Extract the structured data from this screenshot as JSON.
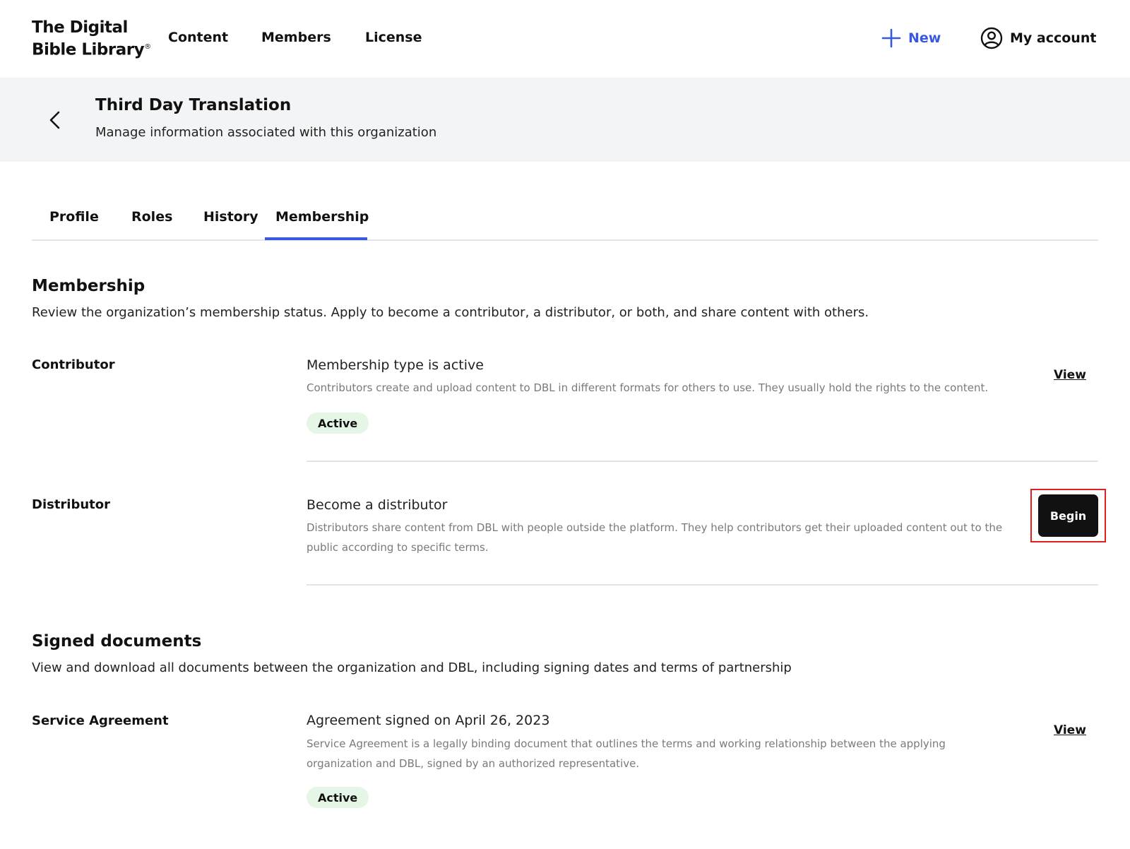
{
  "nav": {
    "logo_line1": "The Digital",
    "logo_line2": "Bible Library",
    "logo_mark": "®",
    "links": [
      "Content",
      "Members",
      "License"
    ],
    "new_label": "New",
    "account_label": "My account"
  },
  "header": {
    "title": "Third Day Translation",
    "subtitle": "Manage information associated with this organization"
  },
  "tabs": [
    "Profile",
    "Roles",
    "History",
    "Membership"
  ],
  "active_tab": "Membership",
  "membership": {
    "title": "Membership",
    "description": "Review the organization’s membership status. Apply to become a contributor, a distributor, or both, and share content with others.",
    "contributor": {
      "label": "Contributor",
      "title": "Membership type is active",
      "text": "Contributors create and upload content to DBL in different formats for others to use. They usually hold the rights to the content.",
      "badge": "Active",
      "action": "View"
    },
    "distributor": {
      "label": "Distributor",
      "title": "Become a distributor",
      "text": "Distributors share content from DBL with people outside the platform. They help contributors get their uploaded content out to the public according to specific terms.",
      "action": "Begin"
    }
  },
  "signed_documents": {
    "title": "Signed documents",
    "description": "View and download all documents between the organization and DBL, including signing dates and terms of partnership",
    "service_agreement": {
      "label": "Service Agreement",
      "title": "Agreement signed on April 26, 2023",
      "text": "Service Agreement is a legally binding document that outlines the terms and working relationship between the applying organization and DBL, signed by an authorized representative.",
      "badge": "Active",
      "action": "View"
    }
  },
  "colors": {
    "accent": "#3858e0",
    "badge_bg": "#e5f6e7",
    "header_bg": "#f3f4f5",
    "highlight": "#e02020"
  }
}
